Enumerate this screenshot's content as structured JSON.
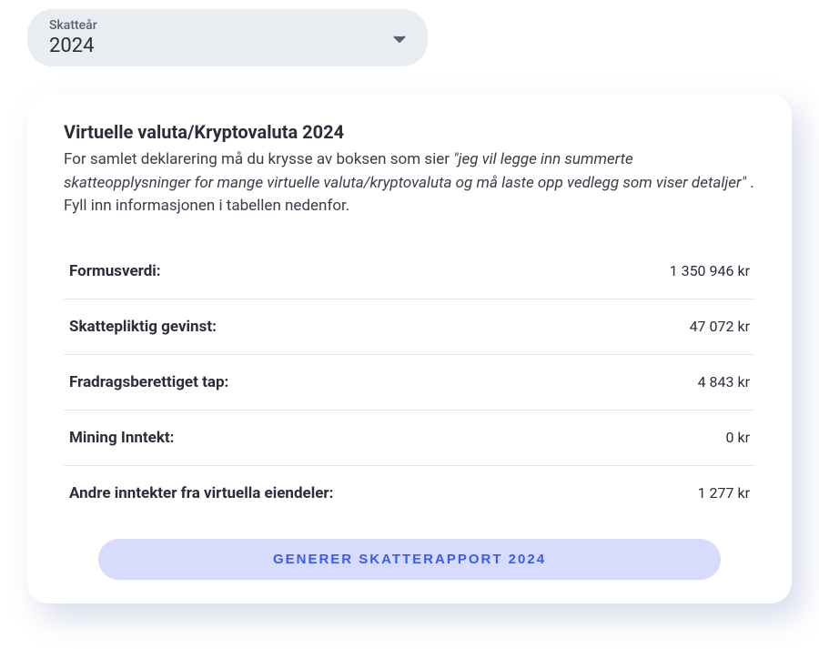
{
  "yearSelector": {
    "label": "Skatteår",
    "value": "2024"
  },
  "card": {
    "title": "Virtuelle valuta/Kryptovaluta 2024",
    "descriptionPre": "For samlet deklarering må du krysse av boksen som sier ",
    "descriptionQuoted": "\"jeg vil legge inn summerte skatteopplysninger for mange virtuelle valuta/kryptovaluta og må laste opp vedlegg som viser detaljer\"",
    "descriptionPost": " . Fyll inn informasjonen i tabellen nedenfor."
  },
  "rows": [
    {
      "label": "Formusverdi:",
      "value": "1 350 946 kr"
    },
    {
      "label": "Skattepliktig gevinst:",
      "value": "47 072 kr"
    },
    {
      "label": "Fradragsberettiget tap:",
      "value": "4 843 kr"
    },
    {
      "label": "Mining Inntekt:",
      "value": "0 kr"
    },
    {
      "label": "Andre inntekter fra virtuella eiendeler:",
      "value": "1 277 kr"
    }
  ],
  "button": {
    "label": "GENERER SKATTERAPPORT 2024"
  }
}
